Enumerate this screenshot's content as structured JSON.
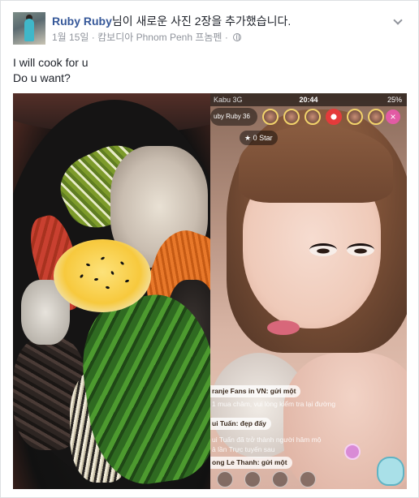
{
  "post": {
    "author": "Ruby Ruby",
    "action": "님이 새로운 사진 2장을 추가했습니다.",
    "date": "1월 15일",
    "separator": "·",
    "location": "캄보디아 Phnom Penh 프놈펜",
    "separator2": "·",
    "privacy_icon": "globe-icon",
    "menu_icon": "chevron-down-icon",
    "text_lines": [
      "I will cook for u",
      "Do u want?"
    ]
  },
  "photos": {
    "left": {
      "subject": "bibimbap-bowl"
    },
    "right": {
      "status_carrier": "Kabu 3G",
      "status_time": "20:44",
      "status_battery": "25%",
      "host_name": "uby Ruby",
      "host_id": "36",
      "star_label": "0 Star",
      "chat": [
        {
          "text": "ranje Fans in VN: gửi một",
          "faded": false
        },
        {
          "text": "1 mua châm, vui lòng kiểm tra lại đường",
          "faded": true
        },
        {
          "text": "ui Tuấn: đẹp đấy",
          "faded": false
        },
        {
          "text": "ui Tuấn đã trở thành người hâm mộ",
          "faded": true
        },
        {
          "text": "ả lần Trực tuyến sau",
          "faded": true
        },
        {
          "text": "ong Le Thanh: gửi một",
          "faded": false
        }
      ]
    }
  },
  "colors": {
    "link": "#365899",
    "meta": "#90949c",
    "text": "#1d2129",
    "border": "#dddfe2"
  }
}
